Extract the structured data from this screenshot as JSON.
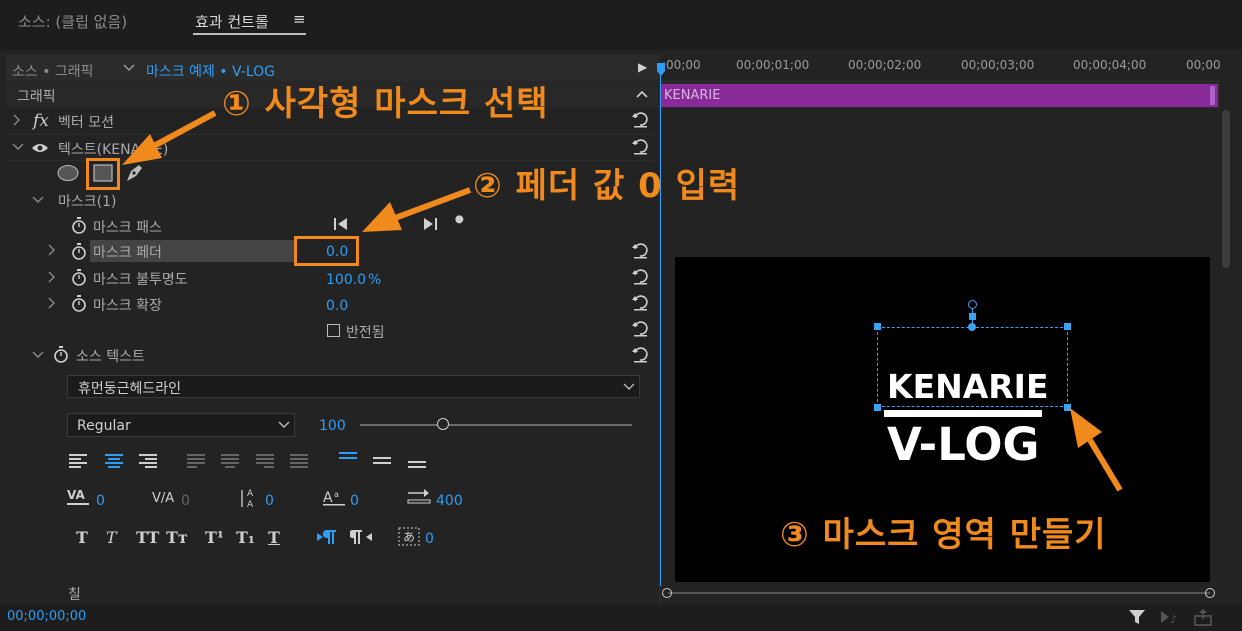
{
  "header": {
    "source_tab": "소스: (클립 없음)",
    "effect_controls_tab": "효과 컨트롤",
    "menu_glyph": "≡"
  },
  "panel": {
    "source_crumb": "소스 • 그래픽",
    "sequence_crumb": "마스크 예제 • V-LOG",
    "play_glyph": "▶",
    "section_label": "그래픽",
    "fx_glyph": "fx",
    "vector_motion": "벡터 모션",
    "text_layer": "텍스트(KENARIE)",
    "mask_label": "마스크(1)",
    "mask_path": "마스크 패스",
    "mask_feather": "마스크 페더",
    "mask_feather_value": "0.0",
    "mask_opacity": "마스크 불투명도",
    "mask_opacity_value": "100.0",
    "mask_opacity_unit": "%",
    "mask_expansion": "마스크 확장",
    "mask_expansion_value": "0.0",
    "inverted": "반전됨",
    "source_text": "소스 텍스트",
    "font_name": "휴먼둥근헤드라인",
    "font_style": "Regular",
    "font_size": "100",
    "font_size_fraction": 0.3,
    "kerning": "0",
    "tracking": "0",
    "leading": "0",
    "baseline": "0",
    "tab_width": "400",
    "tsume": "0",
    "style_buttons": [
      "T",
      "T",
      "TT",
      "Tт",
      "T¹",
      "T₁",
      "T"
    ],
    "fill_label": "칠",
    "timecode": "00;00;00;00"
  },
  "timeline": {
    "ticks": [
      ":00;00",
      "00;00;01;00",
      "00;00;02;00",
      "00;00;03;00",
      "00;00;04;00",
      "00;00"
    ],
    "clip_label": "KENARIE"
  },
  "preview": {
    "title_line1": "KENARIE",
    "title_line2": "V-LOG"
  },
  "annotations": {
    "step1": "① 사각형 마스크 선택",
    "step2": "② 페더 값 0 입력",
    "step3": "③ 마스크 영역 만들기"
  },
  "colors": {
    "accent_blue": "#2d9df5",
    "annotation_orange": "#f08a1d",
    "clip_purple": "#8a2a9a",
    "panel_bg": "#232323"
  }
}
